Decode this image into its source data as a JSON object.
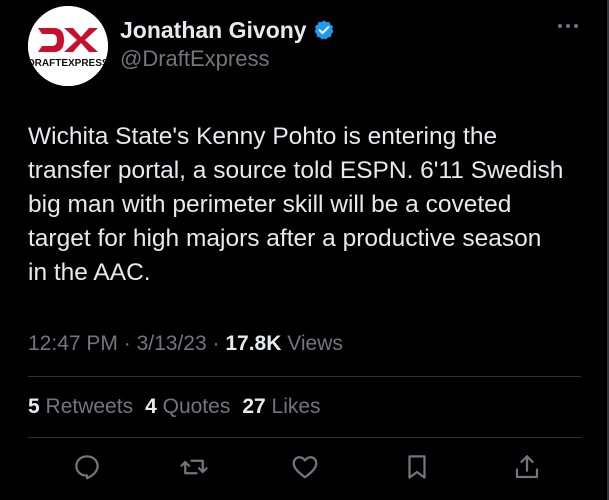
{
  "author": {
    "display_name": "Jonathan Givony",
    "handle": "@DraftExpress",
    "avatar_logo_text": "DX DRAFTEXPRESS",
    "verified": true
  },
  "tweet": {
    "text": "Wichita State's Kenny Pohto is entering the\ntransfer portal, a source told ESPN. 6'11 Swedish\nbig man with perimeter skill will be a coveted\ntarget for high majors after a productive season\nin the AAC.",
    "time": "12:47 PM",
    "separator": "·",
    "date": "3/13/23",
    "views_count": "17.8K",
    "views_label": "Views"
  },
  "stats": {
    "retweets_count": "5",
    "retweets_label": "Retweets",
    "quotes_count": "4",
    "quotes_label": "Quotes",
    "likes_count": "27",
    "likes_label": "Likes"
  },
  "icons": {
    "verified": "verified-badge-icon",
    "more": "more-horizontal-icon",
    "reply": "reply-icon",
    "retweet": "retweet-icon",
    "like": "heart-icon",
    "bookmark": "bookmark-icon",
    "share": "share-icon"
  },
  "colors": {
    "background": "#000000",
    "primary_text": "#e7e9ea",
    "secondary_text": "#71767b",
    "divider": "#2f3336",
    "verified_blue": "#1d9bf0",
    "logo_red": "#c8102e"
  }
}
